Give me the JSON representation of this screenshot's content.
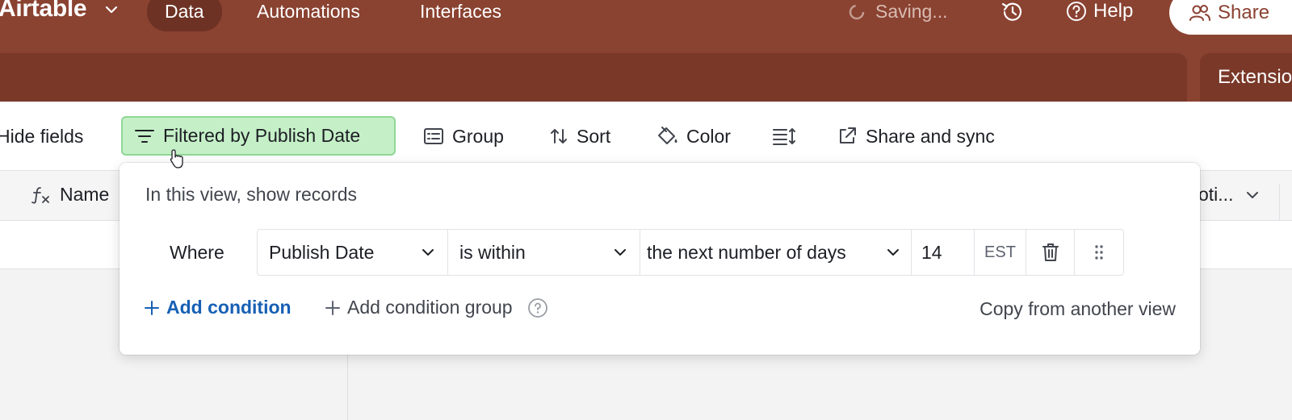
{
  "app": {
    "name": "Airtable"
  },
  "nav": {
    "tabs": [
      "Data",
      "Automations",
      "Interfaces"
    ],
    "active_tab": "Data"
  },
  "topbar": {
    "saving": "Saving...",
    "help": "Help",
    "share": "Share"
  },
  "subbar": {
    "extensions": "Extensio"
  },
  "toolbar": {
    "hide_fields": "Hide fields",
    "filter": "Filtered by Publish Date",
    "group": "Group",
    "sort": "Sort",
    "color": "Color",
    "share_sync": "Share and sync"
  },
  "grid": {
    "primary_column": "Name",
    "right_column": "oti..."
  },
  "filter_popover": {
    "heading": "In this view, show records",
    "where": "Where",
    "condition": {
      "field": "Publish Date",
      "operator": "is within",
      "mode": "the next number of days",
      "value": "14",
      "timezone": "EST"
    },
    "add_condition": "Add condition",
    "add_group": "Add condition group",
    "copy_view": "Copy from another view"
  },
  "colors": {
    "brand_bar": "#8a4231",
    "brand_bar_dark": "#7a3829",
    "filter_active_bg": "#c5f0c7",
    "link_blue": "#1760b4"
  }
}
